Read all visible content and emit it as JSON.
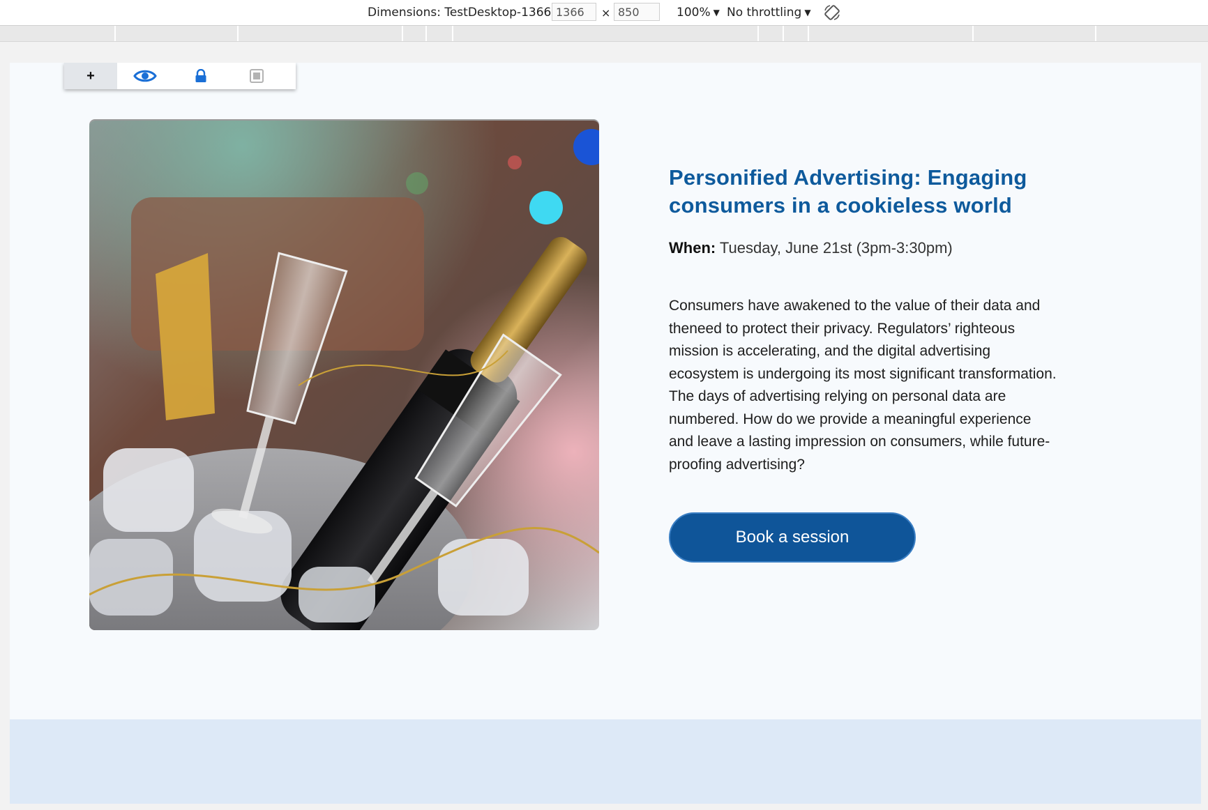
{
  "devtools": {
    "dimensions_label": "Dimensions: TestDesktop-1366",
    "width_value": "1366",
    "times_symbol": "×",
    "height_value": "850",
    "zoom_label": "100%",
    "throttle_label": "No throttling",
    "rotate_icon": "rotate-icon"
  },
  "edit_toolbar": {
    "add_label": "+",
    "icons": [
      "eye-icon",
      "lock-icon",
      "layers-icon"
    ]
  },
  "hero": {
    "image_name": "champagne-bucket-photo"
  },
  "session": {
    "title": "Personified Advertising: Engaging consumers in a cookieless world",
    "when_label": "When:",
    "when_value": "Tuesday, June 21st (3pm-3:30pm)",
    "description": "Consumers have awakened to the value of their data and theneed to protect their privacy. Regulators’ righteous mission is accelerating, and the digital advertising ecosystem is undergoing its most significant transformation. The days of advertising relying on personal data are numbered. How do we provide a meaningful experience and leave a lasting impression on consumers, while future-proofing advertising?",
    "button_label": "Book a session"
  },
  "colors": {
    "accent": "#0e5a9c",
    "button_bg": "#0f5599",
    "page_bg": "#f7fafd",
    "footer_bg": "#dde9f7"
  }
}
